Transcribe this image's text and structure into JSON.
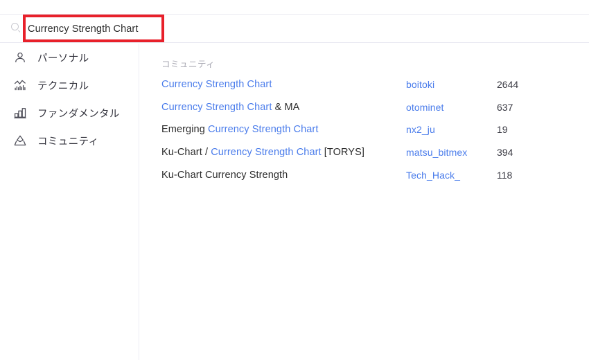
{
  "search": {
    "value": "Currency Strength Chart",
    "placeholder": "",
    "icon": "search-icon"
  },
  "annotation": {
    "color": "#e8202a"
  },
  "sidebar": {
    "items": [
      {
        "label": "パーソナル",
        "icon": "person-icon"
      },
      {
        "label": "テクニカル",
        "icon": "line-bar-chart-icon"
      },
      {
        "label": "ファンダメンタル",
        "icon": "bar-chart-icon"
      },
      {
        "label": "コミュニティ",
        "icon": "community-mountain-icon"
      }
    ]
  },
  "results": {
    "section_label": "コミュニティ",
    "link_color": "#4a7ceb",
    "rows": [
      {
        "parts": [
          {
            "text": "Currency Strength Chart",
            "highlight": true
          }
        ],
        "author": "boitoki",
        "count": "2644"
      },
      {
        "parts": [
          {
            "text": "Currency Strength Chart",
            "highlight": true
          },
          {
            "text": " & MA",
            "highlight": false
          }
        ],
        "author": "otominet",
        "count": "637"
      },
      {
        "parts": [
          {
            "text": "Emerging ",
            "highlight": false
          },
          {
            "text": "Currency Strength Chart",
            "highlight": true
          }
        ],
        "author": "nx2_ju",
        "count": "19"
      },
      {
        "parts": [
          {
            "text": "Ku-Chart / ",
            "highlight": false
          },
          {
            "text": "Currency Strength Chart",
            "highlight": true
          },
          {
            "text": " [TORYS]",
            "highlight": false
          }
        ],
        "author": "matsu_bitmex",
        "count": "394"
      },
      {
        "parts": [
          {
            "text": "Ku-Chart Currency Strength",
            "highlight": false
          }
        ],
        "author": "Tech_Hack_",
        "count": "118"
      }
    ]
  }
}
